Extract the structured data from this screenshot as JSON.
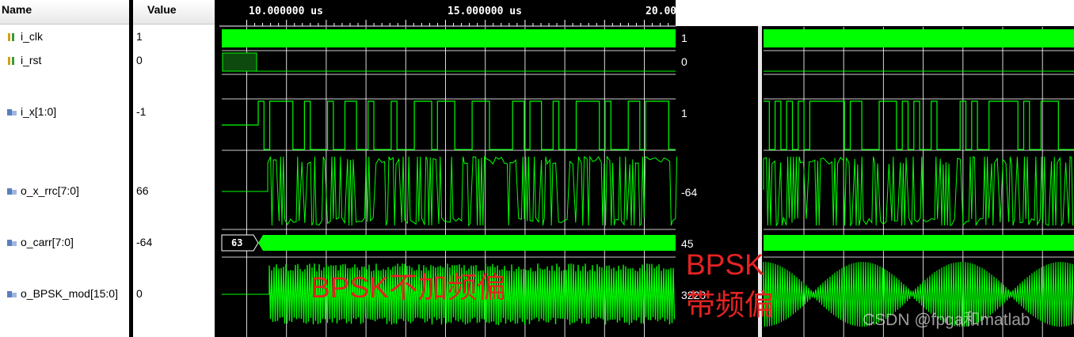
{
  "header": {
    "name_col": "Name",
    "value_col": "Value"
  },
  "timeline": {
    "tick_labels": [
      "10.000000 us",
      "15.000000 us",
      "20.00"
    ]
  },
  "signals": [
    {
      "name": "i_clk",
      "value": "1",
      "value2": "1",
      "icon": "bit-signal-icon"
    },
    {
      "name": "i_rst",
      "value": "0",
      "value2": "0",
      "icon": "bit-signal-icon"
    },
    {
      "name": "i_x[1:0]",
      "value": "-1",
      "value2": "1",
      "icon": "bus-signal-icon"
    },
    {
      "name": "o_x_rrc[7:0]",
      "value": "66",
      "value2": "-64",
      "icon": "bus-signal-icon"
    },
    {
      "name": "o_carr[7:0]",
      "value": "-64",
      "value2": "45",
      "icon": "bus-signal-icon"
    },
    {
      "name": "o_BPSK_mod[15:0]",
      "value": "0",
      "value2": "3220",
      "icon": "bus-signal-icon"
    }
  ],
  "bus_label": "63",
  "annotations": {
    "left": "BPSK不加频偏",
    "right_line1": "BPSK",
    "right_line2": "带频偏"
  },
  "watermark": "CSDN @fpga和matlab",
  "colors": {
    "wave": "#00ff00",
    "annotation": "#e52222",
    "grid": "#ffffff"
  }
}
